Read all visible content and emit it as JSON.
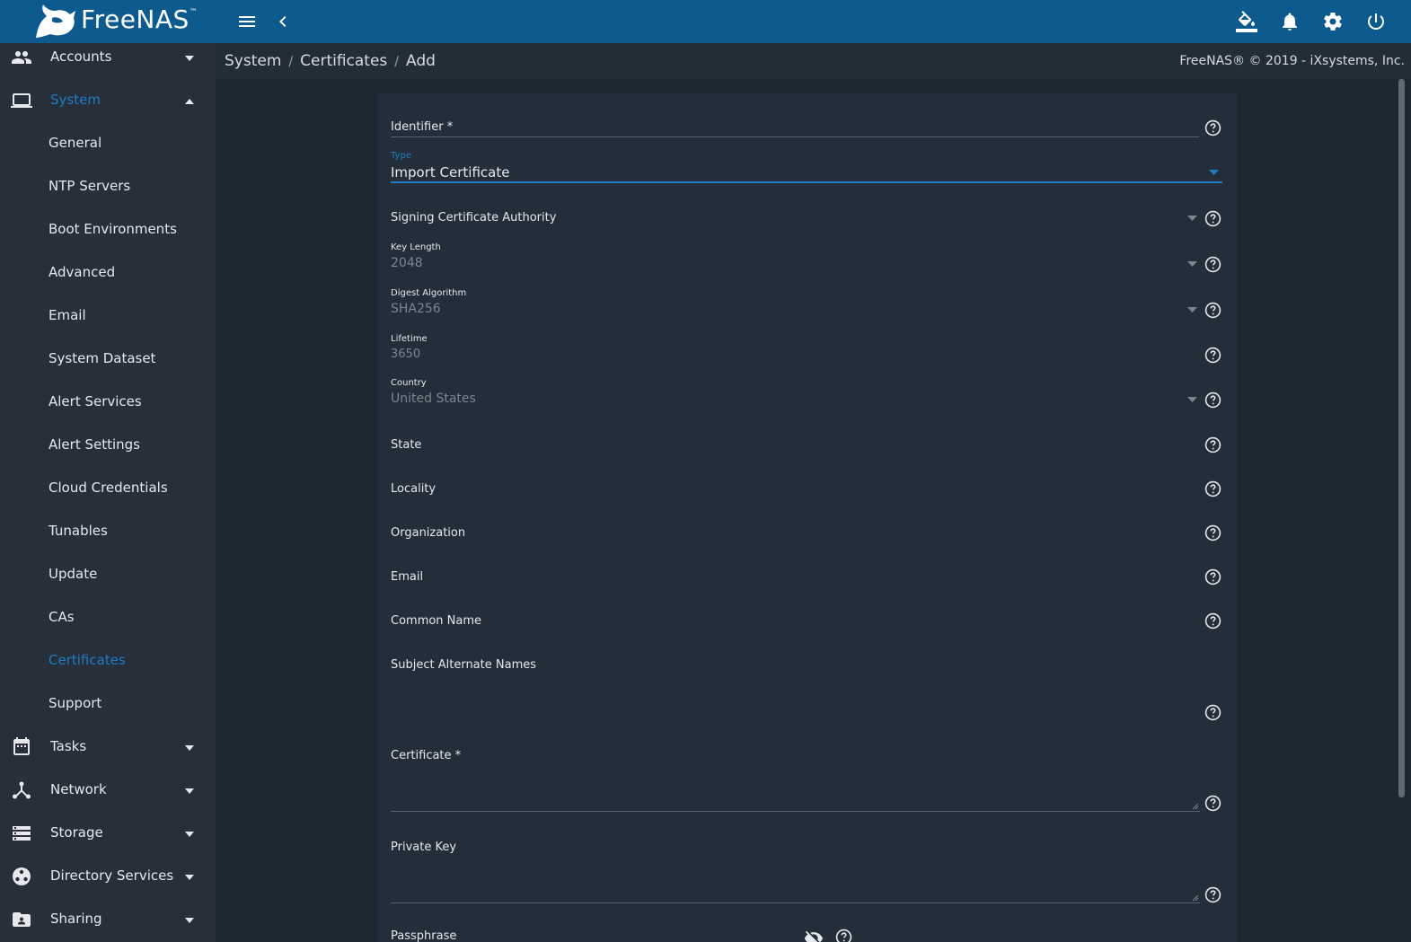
{
  "app": {
    "logo_text": "FreeNAS",
    "logo_mark": "™"
  },
  "topbar": {
    "icons": [
      "menu-icon",
      "chevron-left-icon",
      "theme-bucket-icon",
      "bell-icon",
      "gear-icon",
      "power-icon"
    ]
  },
  "breadcrumb": {
    "items": [
      "System",
      "Certificates",
      "Add"
    ],
    "separator": "/"
  },
  "copyright": "FreeNAS® © 2019 - iXsystems, Inc.",
  "sidebar": {
    "top": [
      {
        "label": "Accounts",
        "icon": "people-icon"
      },
      {
        "label": "System",
        "icon": "laptop-icon"
      },
      {
        "label": "Tasks",
        "icon": "calendar-icon"
      },
      {
        "label": "Network",
        "icon": "network-icon"
      },
      {
        "label": "Storage",
        "icon": "storage-icon"
      },
      {
        "label": "Directory Services",
        "icon": "directory-icon"
      },
      {
        "label": "Sharing",
        "icon": "folder-share-icon"
      }
    ],
    "system_items": [
      "General",
      "NTP Servers",
      "Boot Environments",
      "Advanced",
      "Email",
      "System Dataset",
      "Alert Services",
      "Alert Settings",
      "Cloud Credentials",
      "Tunables",
      "Update",
      "CAs",
      "Certificates",
      "Support"
    ],
    "active": "Certificates"
  },
  "form": {
    "identifier": {
      "label": "Identifier *",
      "value": ""
    },
    "type": {
      "label": "Type",
      "value": "Import Certificate"
    },
    "signing_ca": {
      "label": "Signing Certificate Authority",
      "value": ""
    },
    "key_length": {
      "label": "Key Length",
      "value": "2048"
    },
    "digest": {
      "label": "Digest Algorithm",
      "value": "SHA256"
    },
    "lifetime": {
      "label": "Lifetime",
      "value": "3650"
    },
    "country": {
      "label": "Country",
      "value": "United States"
    },
    "state": {
      "label": "State",
      "value": ""
    },
    "locality": {
      "label": "Locality",
      "value": ""
    },
    "organization": {
      "label": "Organization",
      "value": ""
    },
    "email": {
      "label": "Email",
      "value": ""
    },
    "common_name": {
      "label": "Common Name",
      "value": ""
    },
    "san": {
      "label": "Subject Alternate Names",
      "value": ""
    },
    "certificate": {
      "label": "Certificate *",
      "value": ""
    },
    "private_key": {
      "label": "Private Key",
      "value": ""
    },
    "passphrase": {
      "label": "Passphrase",
      "value": ""
    }
  },
  "colors": {
    "topbar": "#0d5a8e",
    "sidebar": "#262f3a",
    "content": "#1e2833",
    "card": "#242e3a",
    "accent": "#1d7ec3"
  }
}
